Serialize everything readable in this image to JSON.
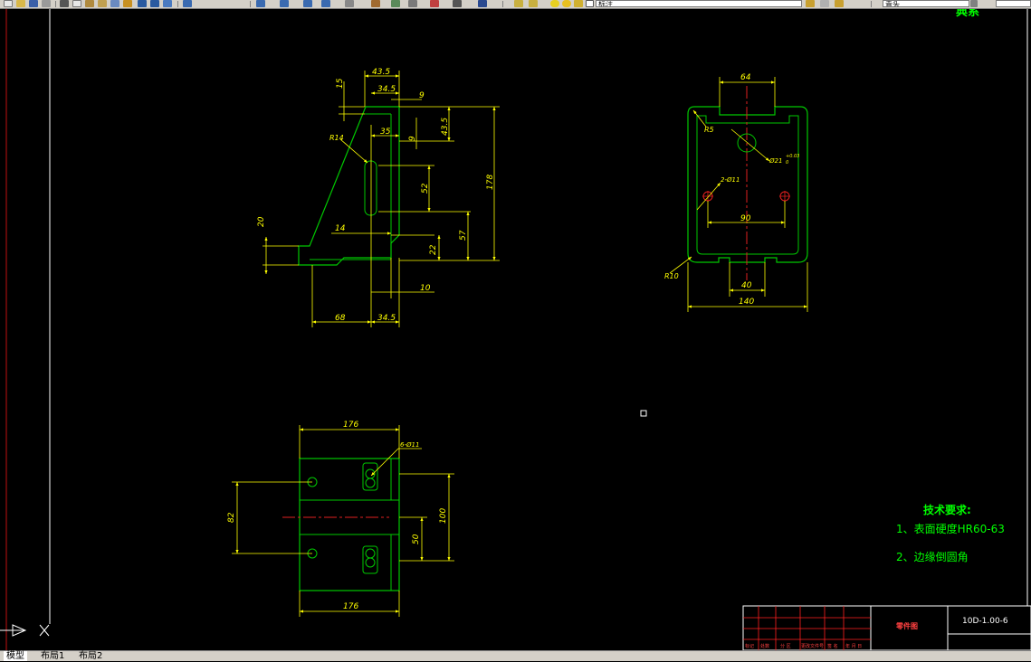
{
  "toolbar": {
    "style_value": "标注",
    "layer_value": "青头"
  },
  "drawing": {
    "corner_label": "典系",
    "front_view": {
      "dims": {
        "d43_5_top": "43.5",
        "d34_5_top": "34.5",
        "d9_a": "9",
        "d15": "15",
        "d35": "35",
        "d9_b": "9",
        "d43_5_right": "43.5",
        "d178": "178",
        "dR14": "R14",
        "d52": "52",
        "d20": "20",
        "d14": "14",
        "d22": "22",
        "d57": "57",
        "d10": "10",
        "d68": "68",
        "d34_5_bottom": "34.5"
      }
    },
    "side_view": {
      "dims": {
        "d64": "64",
        "dR5": "R5",
        "dphi21": "Ø21",
        "dphi21_tol_up": "+0.03",
        "dphi21_tol_lo": "0",
        "d2phi11": "2-Ø11",
        "d90": "90",
        "dR10": "R10",
        "d40": "40",
        "d140": "140"
      }
    },
    "top_view": {
      "dims": {
        "d176_top": "176",
        "d6phi11": "6-Ø11",
        "d82": "82",
        "d100": "100",
        "d50": "50",
        "d176_bottom": "176"
      }
    },
    "notes": {
      "title": "技术要求:",
      "line1": "1、表面硬度HR60-63",
      "line2": "2、边缘倒圆角"
    },
    "title_block": {
      "part_name": "零件图",
      "drawing_no": "10D-1.00-6",
      "headers": [
        "标记",
        "处数",
        "分 区",
        "更改文件号",
        "签 名",
        "年 月 日"
      ]
    }
  },
  "layout_tabs": {
    "model": "模型",
    "layout1": "布局1",
    "layout2": "布局2"
  },
  "colors": {
    "background": "#000000",
    "part_outline": "#00c800",
    "dimension": "#ffff00",
    "centerline": "#e02020",
    "note_text": "#00ff00",
    "title_block": "#ff2020"
  }
}
